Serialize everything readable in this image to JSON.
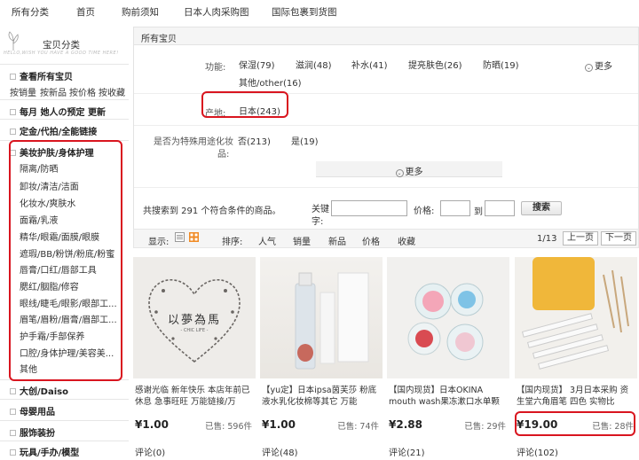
{
  "nav": {
    "items": [
      "所有分类",
      "首页",
      "购前须知",
      "日本人肉采购图",
      "国际包裹到货图"
    ]
  },
  "sidebar": {
    "title": "宝贝分类",
    "slogan": "HELLO,WISH YOU HAVE A GOOD TIME HERE!",
    "all_label": "查看所有宝贝",
    "sort_links": [
      "按销量",
      "按新品",
      "按价格",
      "按收藏"
    ],
    "sections": [
      "每月 她人の预定 更新",
      "定金/代拍/全能链接",
      "美妆护肤/身体护理",
      "大创/Daiso",
      "母婴用品",
      "服饰装扮",
      "玩具/手办/模型"
    ],
    "beauty_items": [
      "隔离/防晒",
      "卸妆/清洁/洁面",
      "化妆水/爽肤水",
      "面霜/乳液",
      "精华/眼霜/面膜/眼膜",
      "遮瑕/BB/粉饼/粉底/粉蜜",
      "唇膏/口红/唇部工具",
      "腮红/胭脂/修容",
      "眼线/睫毛/眼影/眼部工...",
      "眉笔/眉粉/眉膏/眉部工...",
      "护手霜/手部保养",
      "口腔/身体护理/美容美...",
      "其他"
    ]
  },
  "filter": {
    "header": "所有宝贝",
    "function_label": "功能:",
    "function_values": [
      "保湿(79)",
      "滋润(48)",
      "补水(41)",
      "提亮肤色(26)",
      "防晒(19)",
      "其他/other(16)"
    ],
    "more_label": "更多",
    "origin_label": "产地:",
    "origin_value": "日本(243)",
    "special_label_1": "是否为特殊用途化妆",
    "special_label_2": "品:",
    "special_values": [
      "否(213)",
      "是(19)"
    ],
    "more_bar_label": "更多",
    "result_text": "共搜索到 291 个符合条件的商品。",
    "keyword_label_1": "关键",
    "keyword_label_2": "字:",
    "price_label": "价格:",
    "to_label": "到",
    "search_button": "搜索"
  },
  "sortbar": {
    "display_label": "显示:",
    "sort_label": "排序:",
    "sort_options": [
      "人气",
      "销量",
      "新品",
      "价格",
      "收藏"
    ],
    "page_indicator": "1/13",
    "prev": "上一页",
    "next": "下一页"
  },
  "products": [
    {
      "title": "感谢光临 新年快乐 本店年前已休息 急事旺旺 万能链接/万",
      "price": "¥1.00",
      "sold": "已售: 596件",
      "comments_label": "评论(0)",
      "image_text": "以夢為馬",
      "image_sub": "- CHIC LIFE -"
    },
    {
      "title": "【yu定】日本ipsa茵芙莎 粉底液水乳化妆棉等其它 万能",
      "price": "¥1.00",
      "sold": "已售: 74件",
      "comments_label": "评论(48)"
    },
    {
      "title": "【国内现货】日本OKINA mouth wash果冻漱口水单颗",
      "price": "¥2.88",
      "sold": "已售: 29件",
      "comments_label": "评论(21)"
    },
    {
      "title": "【国内现货】 3月日本采购 资生堂六角眉笔 四色 实物比",
      "price": "¥19.00",
      "sold": "已售: 28件",
      "comments_label": "评论(102)"
    }
  ],
  "colors": {
    "highlight": "#d9151f",
    "accent_orange": "#f08a24"
  }
}
